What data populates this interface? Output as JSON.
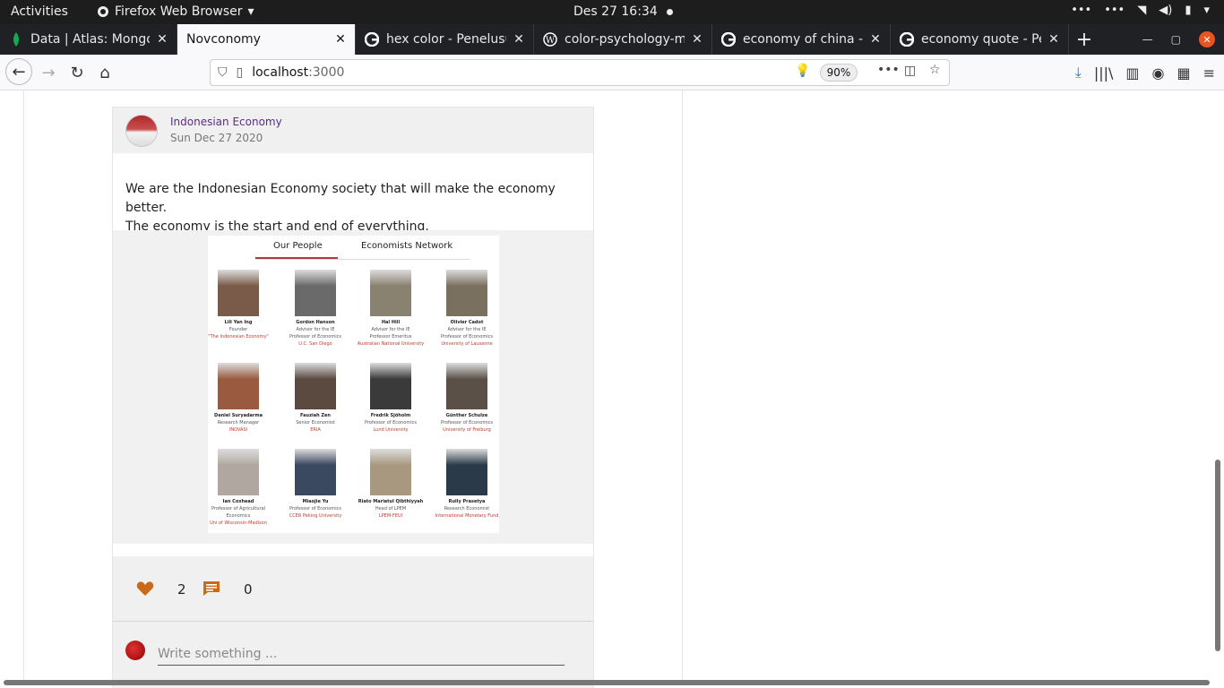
{
  "topbar": {
    "activities": "Activities",
    "app_name": "Firefox Web Browser",
    "clock": "Des 27  16:34"
  },
  "tabs": [
    {
      "title": "Data | Atlas: MongoD",
      "icon": "mongodb-leaf-icon",
      "active": false
    },
    {
      "title": "Novconomy",
      "icon": "",
      "active": true
    },
    {
      "title": "hex color - Penelusur",
      "icon": "google-icon",
      "active": false
    },
    {
      "title": "color-psychology-me",
      "icon": "wordpress-icon",
      "active": false
    },
    {
      "title": "economy of china - G",
      "icon": "google-icon",
      "active": false
    },
    {
      "title": "economy quote - Pen",
      "icon": "google-icon",
      "active": false
    }
  ],
  "url": {
    "host": "localhost",
    "port": ":3000",
    "zoom": "90%"
  },
  "post": {
    "author": "Indonesian Economy",
    "date": "Sun Dec 27 2020",
    "text_line1": "We are the Indonesian Economy society that will make the economy better.",
    "text_line2": "The economy is the start and end of everything.",
    "image": {
      "tab_people": "Our People",
      "tab_network": "Economists Network",
      "people": [
        {
          "name": "Lili Yan Ing",
          "role": "Founder",
          "role2": "",
          "org": "\"The Indonesian Economy\""
        },
        {
          "name": "Gordon Hanson",
          "role": "Advisor for the IE",
          "role2": "Professor of Economics",
          "org": "U.C. San Diego"
        },
        {
          "name": "Hal Hill",
          "role": "Advisor for the IE",
          "role2": "Professor Emeritus",
          "org": "Australian National University"
        },
        {
          "name": "Olivier Cadot",
          "role": "Advisor for the IE",
          "role2": "Professor of Economics",
          "org": "University of Lausanne"
        },
        {
          "name": "Daniel Suryadarma",
          "role": "Research Manager",
          "role2": "",
          "org": "INOVASI"
        },
        {
          "name": "Fauziah Zen",
          "role": "Senior Economist",
          "role2": "",
          "org": "ERIA"
        },
        {
          "name": "Fredrik Sjöholm",
          "role": "Professor of Economics",
          "role2": "",
          "org": "Lund University"
        },
        {
          "name": "Günther Schulze",
          "role": "Professor of Economics",
          "role2": "",
          "org": "University of Freiburg"
        },
        {
          "name": "Ian Coxhead",
          "role": "Professor of Agricultural",
          "role2": "Economics",
          "org": "Uni of Wisconsin-Madison"
        },
        {
          "name": "Miaojie Yu",
          "role": "Professor of Economics",
          "role2": "",
          "org": "CCER Peking University"
        },
        {
          "name": "Riato Mariatul Qibthiyyah",
          "role": "Head of LPEM",
          "role2": "",
          "org": "LPEM-FEUI"
        },
        {
          "name": "Rully Prasetya",
          "role": "Research Economist",
          "role2": "",
          "org": "International Monetary Fund"
        }
      ]
    },
    "likes": "2",
    "comments": "0",
    "reply_placeholder": "Write something ..."
  },
  "colors": {
    "accent_icon": "#c96a1a",
    "author_link": "#5b2d8a",
    "org_red": "#c0392b"
  }
}
